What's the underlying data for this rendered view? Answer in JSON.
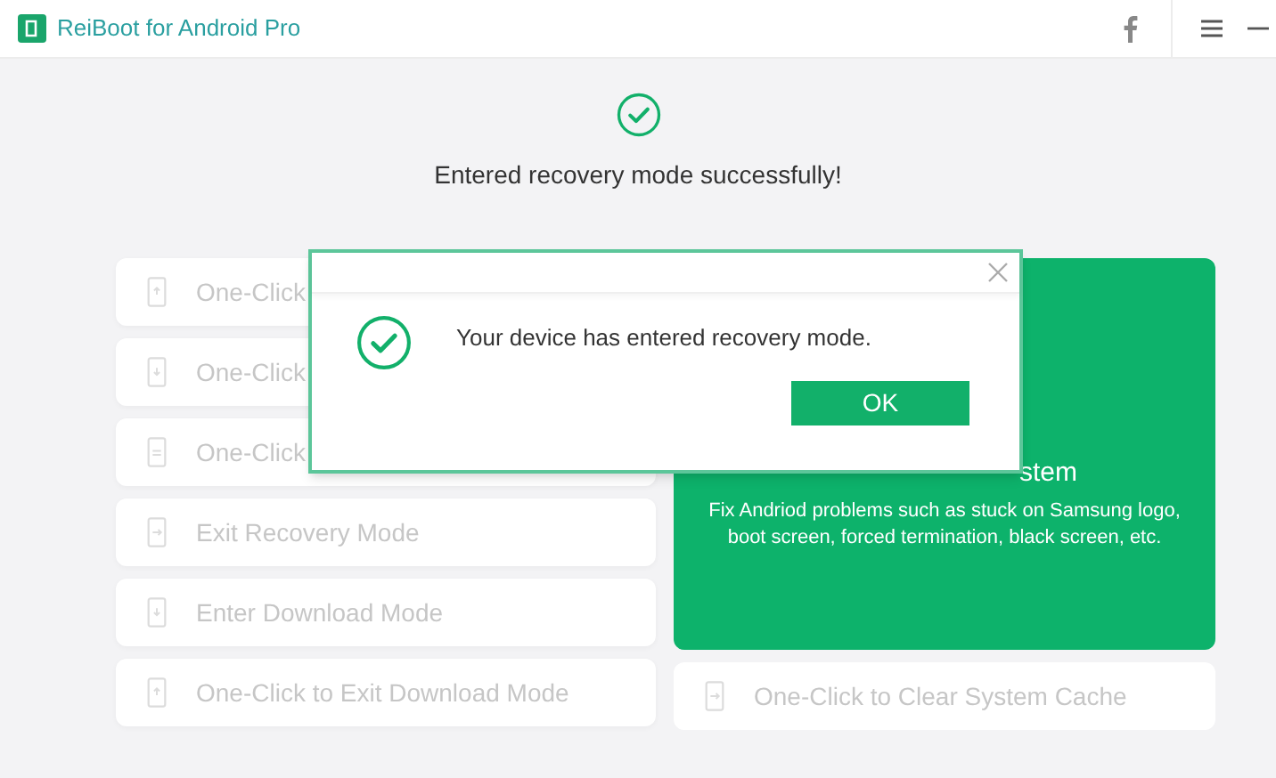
{
  "window": {
    "title": "ReiBoot for Android Pro"
  },
  "status": {
    "message": "Entered recovery mode successfully!"
  },
  "left_buttons": [
    {
      "label": "One-Click"
    },
    {
      "label": "One-Click"
    },
    {
      "label": "One-Click"
    },
    {
      "label": "Exit Recovery Mode"
    },
    {
      "label": "Enter Download Mode"
    },
    {
      "label": "One-Click to Exit Download Mode"
    }
  ],
  "repair_card": {
    "title": "stem",
    "description": "Fix Andriod problems such as stuck on Samsung logo, boot screen, forced termination, black screen, etc."
  },
  "cache_button": {
    "label": "One-Click to Clear System Cache"
  },
  "dialog": {
    "message": "Your device has entered recovery mode.",
    "ok": "OK"
  }
}
